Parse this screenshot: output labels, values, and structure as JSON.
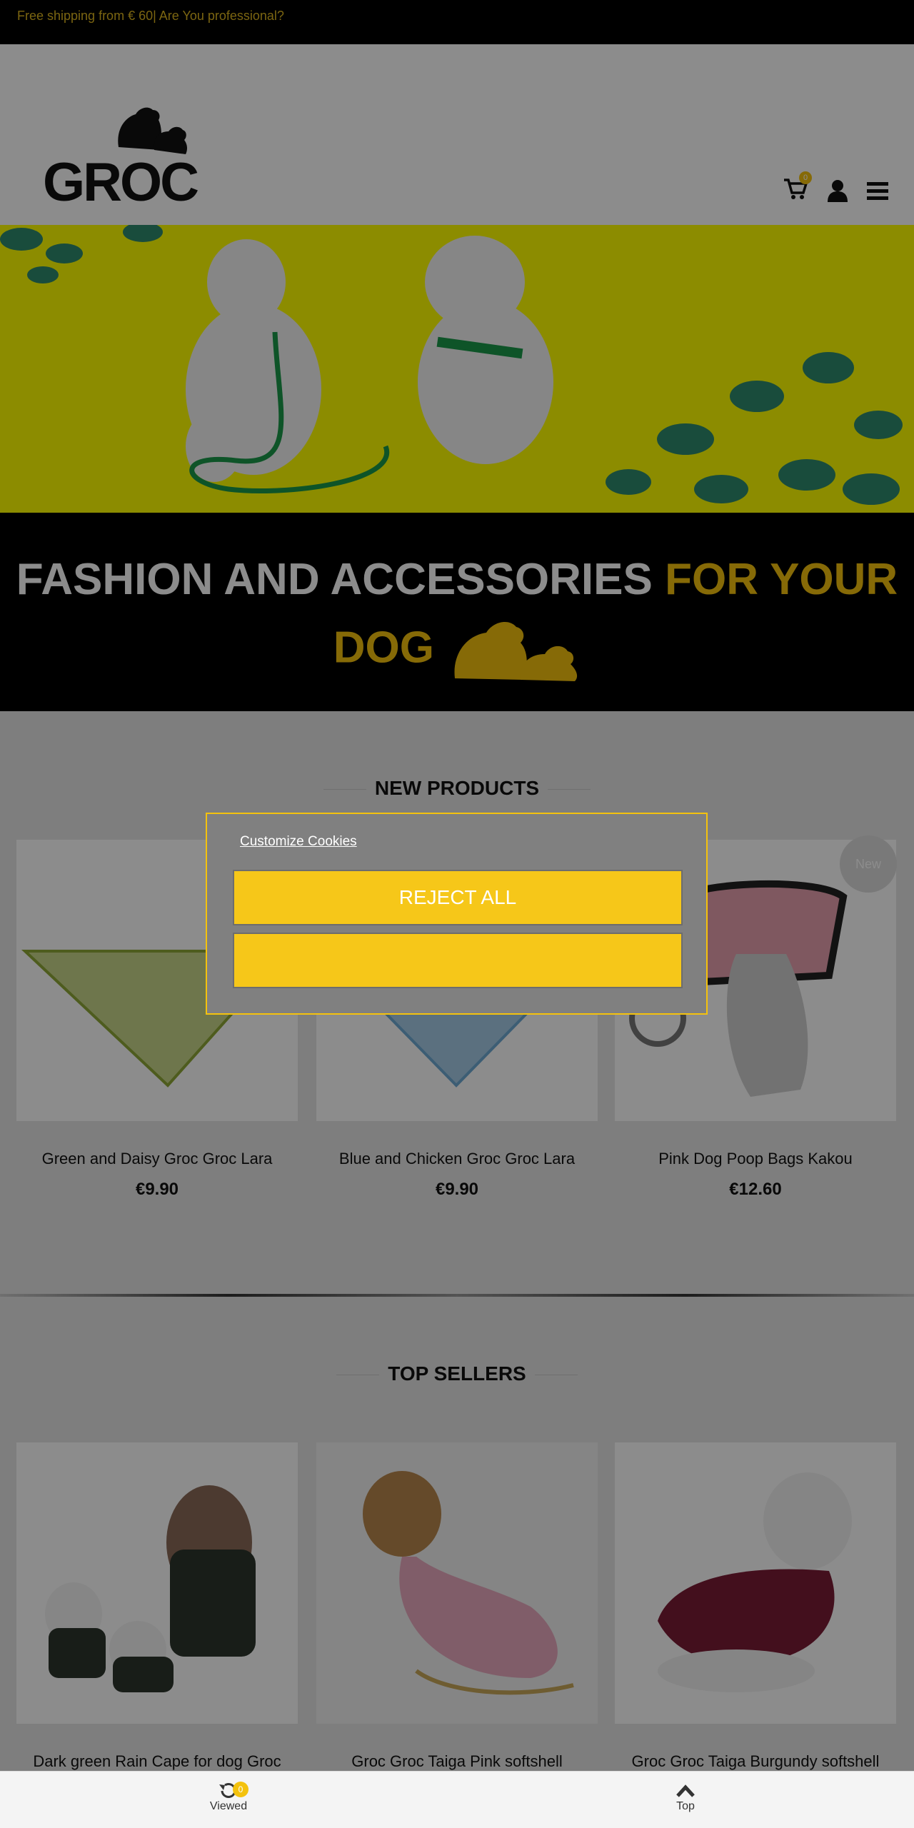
{
  "topbar": {
    "shipping_text": "Free shipping from € 60| Are You professional?"
  },
  "header": {
    "logo_text": "GROC",
    "cart_count": "0"
  },
  "tagline": {
    "white_part": "FASHION AND ACCESSORIES",
    "highlight_part": "FOR YOUR",
    "line2": "DOG"
  },
  "new_products": {
    "title": "NEW PRODUCTS",
    "badge": "New",
    "items": [
      {
        "name": "Green and Daisy Groc Groc Lara",
        "price": "€9.90"
      },
      {
        "name": "Blue and Chicken Groc Groc Lara",
        "price": "€9.90"
      },
      {
        "name": "Pink Dog Poop Bags Kakou",
        "price": "€12.60"
      }
    ]
  },
  "top_sellers": {
    "title": "TOP SELLERS",
    "items": [
      {
        "name": "Dark green Rain Cape for dog Groc"
      },
      {
        "name": "Groc Groc Taiga Pink softshell"
      },
      {
        "name": "Groc Groc Taiga Burgundy softshell"
      }
    ]
  },
  "cookie": {
    "customize_label": "Customize Cookies",
    "reject_label": "REJECT ALL",
    "accept_label": ""
  },
  "bottombar": {
    "viewed_label": "Viewed",
    "viewed_count": "0",
    "top_label": "Top"
  },
  "colors": {
    "brand_yellow": "#f4c20d",
    "hero_bg": "#ffff00",
    "topbar_bg": "#000000"
  }
}
